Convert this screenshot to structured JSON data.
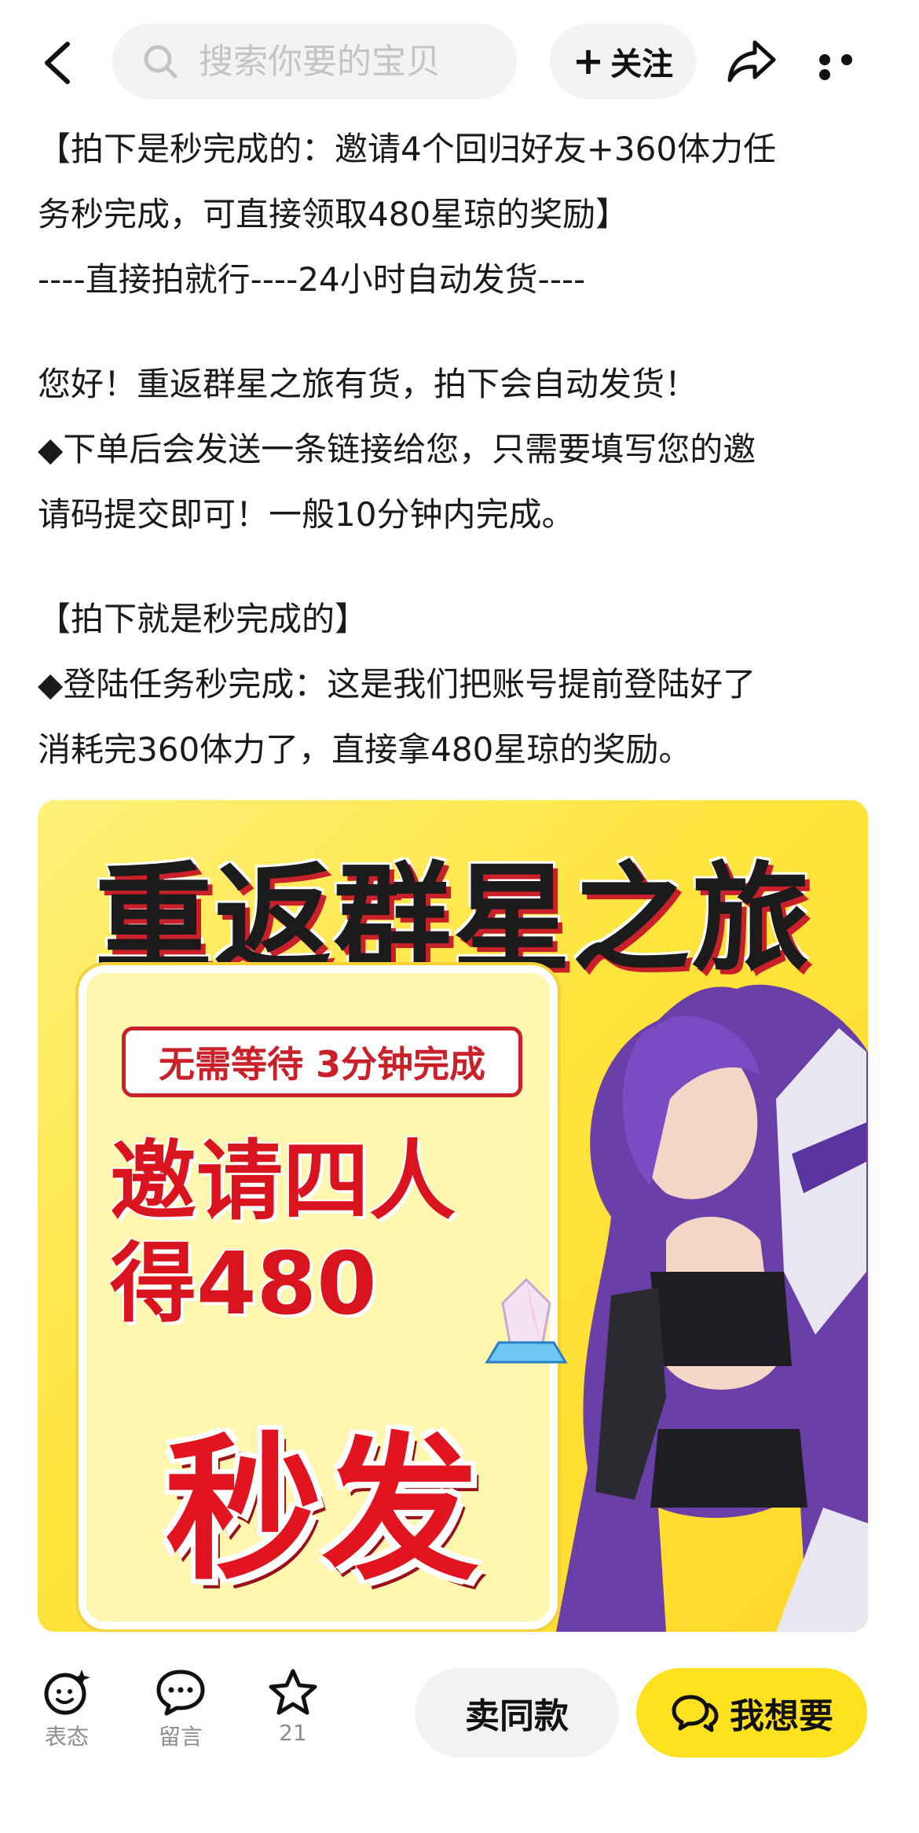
{
  "header": {
    "search_placeholder": "搜索你要的宝贝",
    "follow_label": "关注"
  },
  "description": {
    "lines_block1": [
      "【拍下是秒完成的：邀请4个回归好友+360体力任",
      "务秒完成，可直接领取480星琼的奖励】",
      "----直接拍就行----24小时自动发货----"
    ],
    "lines_block2": [
      "您好！重返群星之旅有货，拍下会自动发货！",
      "◆下单后会发送一条链接给您，只需要填写您的邀",
      "请码提交即可！一般10分钟内完成。"
    ],
    "lines_block3": [
      "【拍下就是秒完成的】",
      "◆登陆任务秒完成：这是我们把账号提前登陆好了",
      "消耗完360体力了，直接拿480星琼的奖励。"
    ]
  },
  "promo_image": {
    "title": "重返群星之旅",
    "badge": "无需等待 3分钟完成",
    "invite_line1": "邀请四人",
    "invite_line2": "得480",
    "flash": "秒发"
  },
  "bottom": {
    "react_label": "表态",
    "comment_label": "留言",
    "favorite_count": "21",
    "sell_same_label": "卖同款",
    "want_label": "我想要"
  },
  "colors": {
    "accent_yellow": "#ffe21f",
    "promo_red": "#d9141e"
  }
}
